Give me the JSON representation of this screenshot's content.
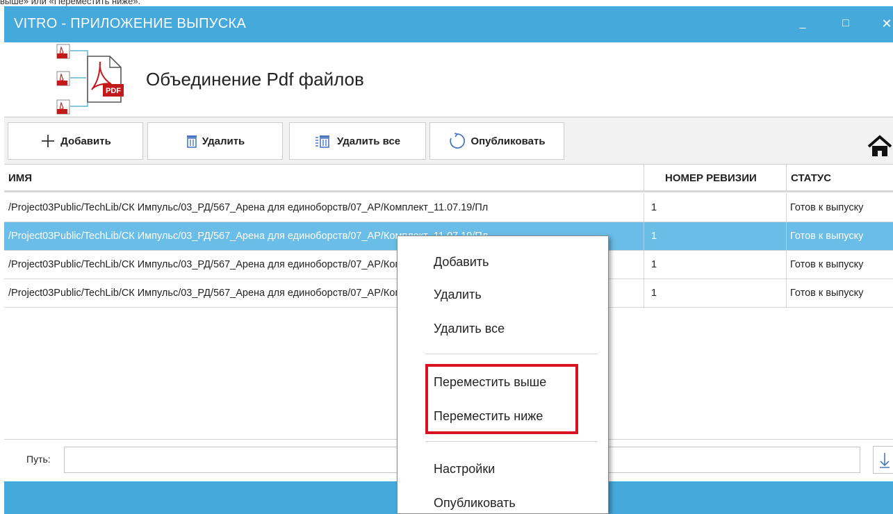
{
  "caption": "выше» или «Переместить ниже».",
  "window": {
    "title": "VITRO - ПРИЛОЖЕНИЕ ВЫПУСКА",
    "minimize_glyph": "_",
    "maximize_glyph": "□",
    "close_glyph": "✕"
  },
  "app": {
    "title": "Объединение Pdf файлов",
    "logo_badge": "PDF"
  },
  "toolbar": {
    "add_label": "Добавить",
    "delete_label": "Удалить",
    "delete_all_label": "Удалить все",
    "publish_label": "Опубликовать"
  },
  "table": {
    "columns": {
      "name": "ИМЯ",
      "revision": "НОМЕР РЕВИЗИИ",
      "status": "СТАТУС"
    },
    "rows": [
      {
        "name": "/Project03Public/TechLib/СК Импульс/03_РД/567_Арена для единоборств/07_АР/Комплект_11.07.19/Пл",
        "revision": "1",
        "status": "Готов к выпуску"
      },
      {
        "name": "/Project03Public/TechLib/СК Импульс/03_РД/567_Арена для единоборств/07_АР/Комплект_11.07.19/Пл",
        "revision": "1",
        "status": "Готов к выпуску"
      },
      {
        "name": "/Project03Public/TechLib/СК Импульс/03_РД/567_Арена для единоборств/07_АР/Комплект_11.07.19/Пл",
        "revision": "1",
        "status": "Готов к выпуску"
      },
      {
        "name": "/Project03Public/TechLib/СК Импульс/03_РД/567_Арена для единоборств/07_АР/Комплект_11.07.19/Пл",
        "revision": "1",
        "status": "Готов к выпуску"
      }
    ],
    "selected_row": 2
  },
  "path": {
    "label": "Путь:",
    "value": ""
  },
  "context_menu": {
    "add": "Добавить",
    "delete": "Удалить",
    "delete_all": "Удалить все",
    "move_up": "Переместить выше",
    "move_down": "Переместить ниже",
    "settings": "Настройки",
    "publish": "Опубликовать"
  },
  "colors": {
    "titlebar": "#45a9dc",
    "selection": "#69bde6",
    "highlight": "#d9141e"
  },
  "icons": [
    "plus-icon",
    "trash-icon",
    "trash-all-icon",
    "publish-refresh-icon",
    "home-icon",
    "download-icon",
    "pdf-merge-logo"
  ]
}
